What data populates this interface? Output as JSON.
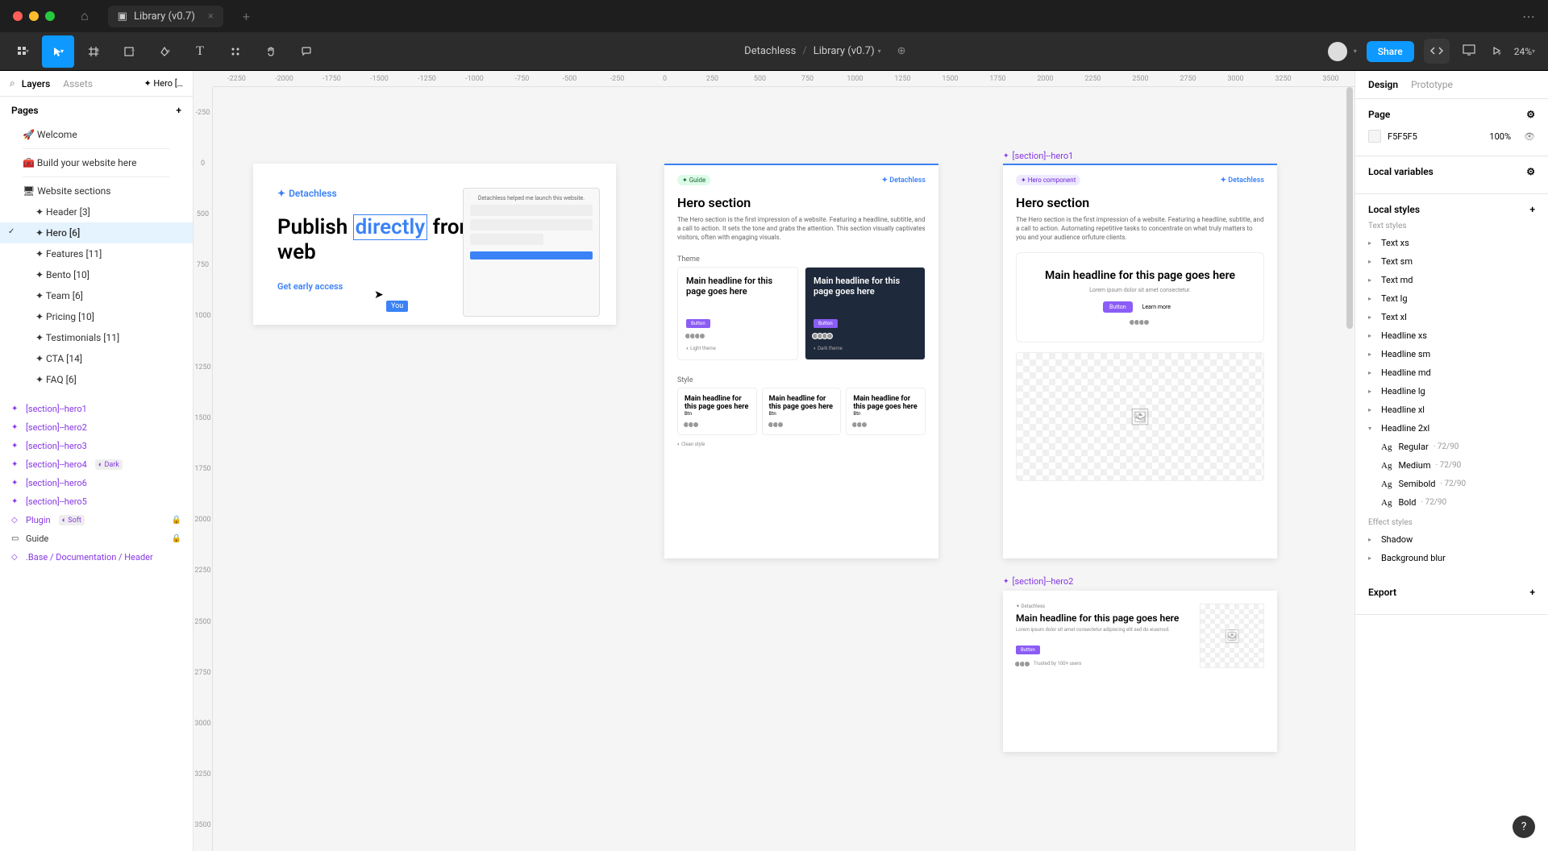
{
  "window": {
    "tab_title": "Library (v0.7)"
  },
  "toolbar": {
    "breadcrumb_parent": "Detachless",
    "breadcrumb_current": "Library (v0.7)",
    "share_label": "Share",
    "zoom": "24%"
  },
  "left_panel": {
    "tabs": {
      "layers": "Layers",
      "assets": "Assets",
      "sparkle": "✦ Hero […"
    },
    "pages_header": "Pages",
    "pages": [
      {
        "label": "🚀 Welcome"
      },
      {
        "label": "🧰 Build your website here"
      },
      {
        "label": "🖥 Website sections"
      }
    ],
    "sections": [
      {
        "label": "✦ Header [3]"
      },
      {
        "label": "✦ Hero [6]",
        "selected": true
      },
      {
        "label": "✦ Features [11]"
      },
      {
        "label": "✦ Bento [10]"
      },
      {
        "label": "✦ Team [6]"
      },
      {
        "label": "✦ Pricing [10]"
      },
      {
        "label": "✦ Testimonials [11]"
      },
      {
        "label": "✦ CTA [14]"
      },
      {
        "label": "✦ FAQ [6]"
      }
    ],
    "layers": [
      {
        "label": "[section]--hero1",
        "purple": true
      },
      {
        "label": "[section]--hero2",
        "purple": true
      },
      {
        "label": "[section]--hero3",
        "purple": true
      },
      {
        "label": "[section]--hero4",
        "purple": true,
        "badge": "◐ Dark"
      },
      {
        "label": "[section]--hero6",
        "purple": true
      },
      {
        "label": "[section]--hero5",
        "purple": true
      },
      {
        "label": "Plugin",
        "purple": true,
        "badge": "◐ Soft",
        "lock": true
      },
      {
        "label": "Guide",
        "lock": true
      },
      {
        "label": ".Base / Documentation / Header",
        "purple": true
      }
    ]
  },
  "rulers": {
    "top": [
      "-2250",
      "-2000",
      "-1750",
      "-1500",
      "-1250",
      "-1000",
      "-750",
      "-500",
      "-250",
      "0",
      "250",
      "500",
      "750",
      "1000",
      "1250",
      "1500",
      "1750",
      "2000",
      "2250",
      "2500",
      "2750",
      "3000",
      "3250",
      "3500"
    ],
    "left": [
      "-250",
      "0",
      "500",
      "750",
      "1000",
      "1250",
      "1500",
      "1750",
      "2000",
      "2250",
      "2500",
      "2750",
      "3000",
      "3250",
      "3500"
    ]
  },
  "canvas": {
    "frame1": {
      "logo": "Detachless",
      "headline_1": "Publish ",
      "headline_highlight": "directly",
      "headline_2": " from Figma to web",
      "cta": "Get early access",
      "you_label": "You",
      "mockup_text": "Detachless helped me launch this website."
    },
    "frame2": {
      "pill": "✦ Guide",
      "logo": "✦ Detachless",
      "title": "Hero section",
      "desc": "The Hero section is the first impression of a website. Featuring a headline, subtitle, and a call to action. It sets the tone and grabs the attention. This section visually captivates visitors, often with engaging visuals.",
      "theme_label": "Theme",
      "style_label": "Style",
      "card_headline": "Main headline for this page goes here",
      "mock_footer_light": "◐ Light theme",
      "mock_footer_dark": "◐ Dark theme",
      "style_footer": "◐ Clean style"
    },
    "frame3": {
      "label": "[section]--hero1",
      "pill": "✦ Hero component",
      "logo": "✦ Detachless",
      "title": "Hero section",
      "desc": "The Hero section is the first impression of a website. Featuring a headline, subtitle, and a call to action. Automating repetitive tasks to concentrate on what truly matters to you and your audience orfuture clients.",
      "mock_headline": "Main headline for this page goes here"
    },
    "frame4": {
      "label": "[section]--hero2",
      "headline": "Main headline for this page goes here",
      "desc": "Lorem ipsum dolor sit amet consectetur adipiscing elit sed do eiusmod.",
      "trust": "Trusted by 100+ users"
    }
  },
  "right_panel": {
    "tabs": {
      "design": "Design",
      "prototype": "Prototype"
    },
    "page_section": {
      "header": "Page",
      "color": "F5F5F5",
      "opacity": "100%"
    },
    "local_vars": "Local variables",
    "local_styles": "Local styles",
    "text_styles_label": "Text styles",
    "text_styles": [
      "Text xs",
      "Text sm",
      "Text md",
      "Text lg",
      "Text xl",
      "Headline xs",
      "Headline sm",
      "Headline md",
      "Headline lg",
      "Headline xl"
    ],
    "headline_2xl": {
      "name": "Headline 2xl",
      "variants": [
        {
          "weight": "Regular",
          "meta": "· 72/90"
        },
        {
          "weight": "Medium",
          "meta": "· 72/90"
        },
        {
          "weight": "Semibold",
          "meta": "· 72/90"
        },
        {
          "weight": "Bold",
          "meta": "· 72/90"
        }
      ]
    },
    "effect_styles_label": "Effect styles",
    "effect_styles": [
      "Shadow",
      "Background blur"
    ],
    "export": "Export"
  }
}
